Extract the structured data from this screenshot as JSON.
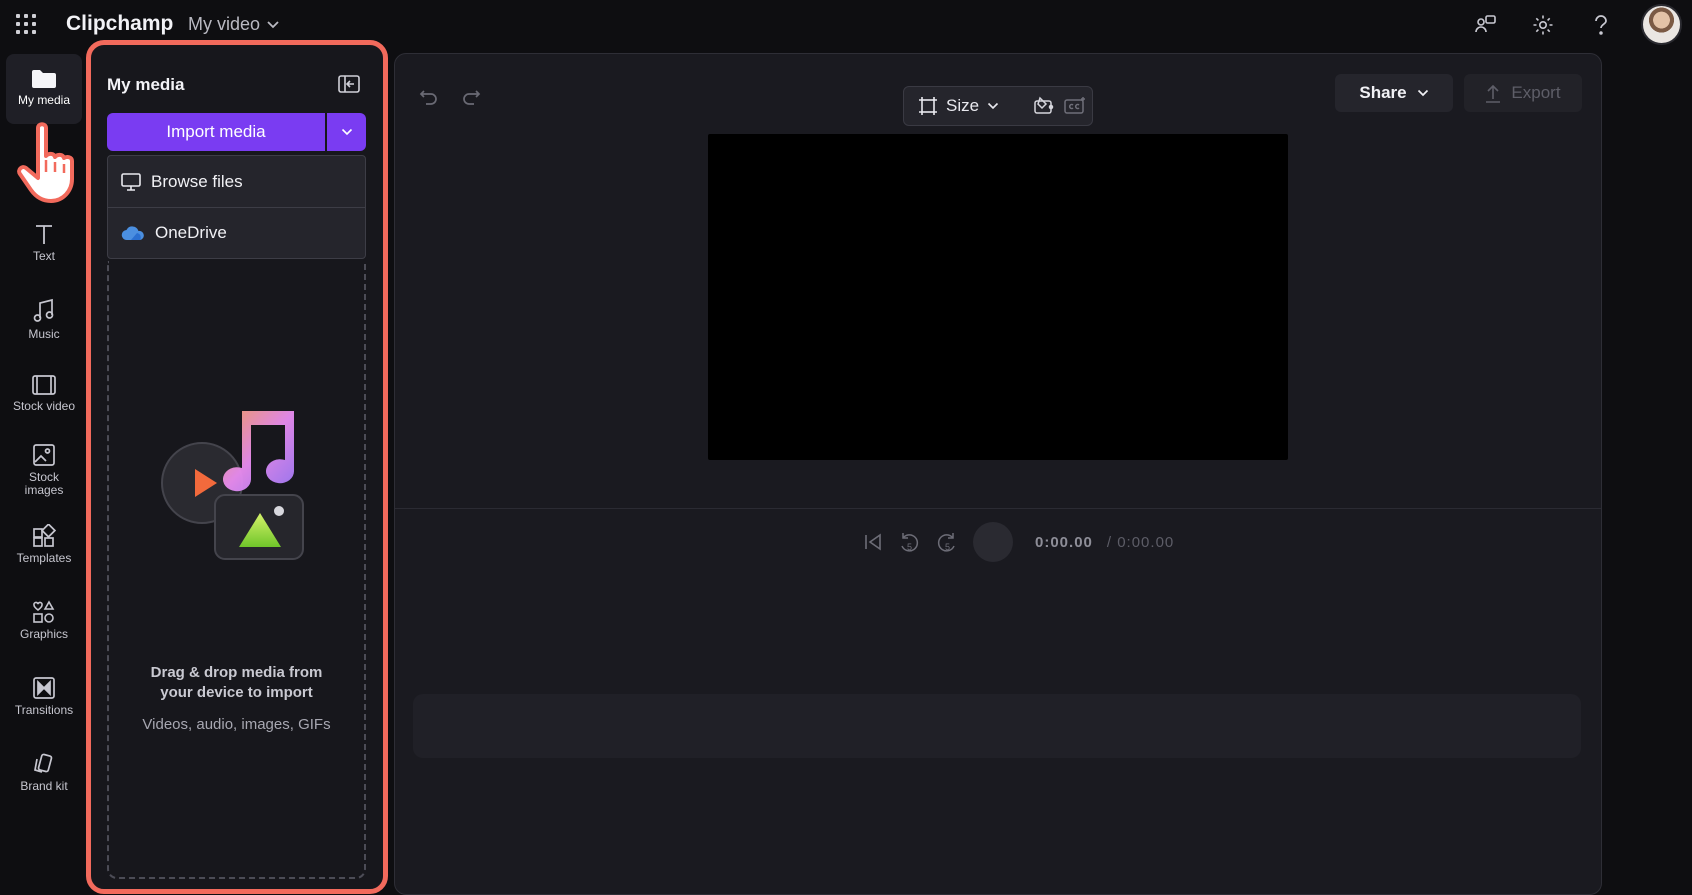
{
  "app": {
    "name": "Clipchamp",
    "project_name": "My video"
  },
  "topbar": {
    "icons": [
      "feedback-icon",
      "settings-icon",
      "help-icon"
    ],
    "avatar": "user-avatar"
  },
  "sidebar": {
    "items": [
      {
        "label": "My media",
        "icon": "folder-icon",
        "active": true
      },
      {
        "label": "Text",
        "icon": "text-icon"
      },
      {
        "label": "Music",
        "icon": "music-icon"
      },
      {
        "label": "Stock video",
        "icon": "film-icon"
      },
      {
        "label": "Stock images",
        "icon": "image-icon"
      },
      {
        "label": "Templates",
        "icon": "templates-icon"
      },
      {
        "label": "Graphics",
        "icon": "shapes-icon"
      },
      {
        "label": "Transitions",
        "icon": "transition-icon"
      },
      {
        "label": "Brand kit",
        "icon": "brand-kit-icon"
      }
    ]
  },
  "media_panel": {
    "title": "My media",
    "import_label": "Import media",
    "dropdown": [
      {
        "label": "Browse files",
        "icon": "monitor-icon"
      },
      {
        "label": "OneDrive",
        "icon": "onedrive-cloud-icon"
      }
    ],
    "dropzone_title_line1": "Drag & drop media from",
    "dropzone_title_line2": "your device to import",
    "dropzone_subtitle": "Videos, audio, images, GIFs"
  },
  "toolbar": {
    "size_label": "Size",
    "share_label": "Share",
    "export_label": "Export"
  },
  "playback": {
    "current_time": "0:00.00",
    "total_time": "/ 0:00.00",
    "skip_seconds": "5"
  },
  "colors": {
    "accent": "#7a3cf2",
    "highlight": "#f26a5c",
    "background": "#0e0e11"
  }
}
